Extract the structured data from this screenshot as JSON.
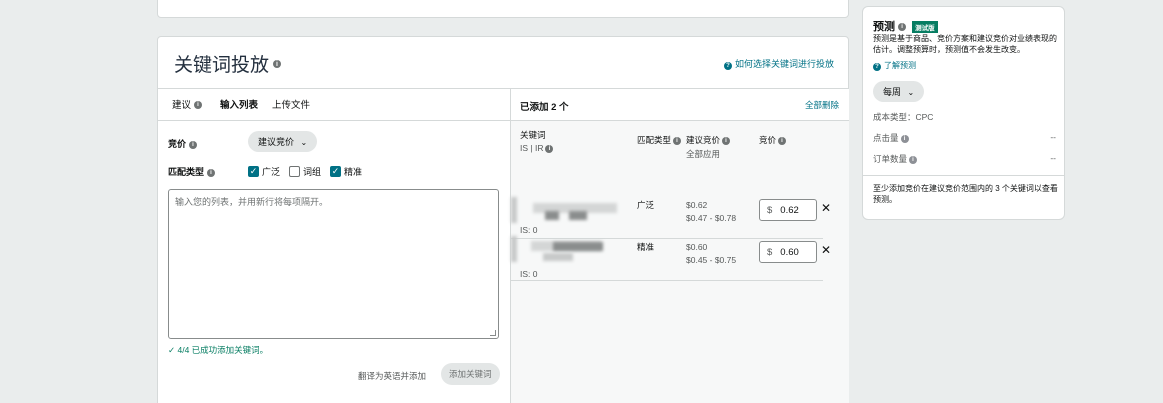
{
  "section": {
    "title": "关键词投放",
    "help_link": "如何选择关键词进行投放"
  },
  "tabs": [
    {
      "label": "建议"
    },
    {
      "label": "输入列表"
    },
    {
      "label": "上传文件"
    }
  ],
  "bid": {
    "label": "竞价",
    "dropdown_value": "建议竞价"
  },
  "match_type": {
    "label": "匹配类型",
    "options": [
      {
        "label": "广泛",
        "checked": true
      },
      {
        "label": "词组",
        "checked": false
      },
      {
        "label": "精准",
        "checked": true
      }
    ]
  },
  "textarea": {
    "placeholder": "输入您的列表，并用新行将每项隔开。"
  },
  "success_message": "4/4 已成功添加关键词。",
  "translate_label": "翻译为英语并添加",
  "add_keywords_button": "添加关键词",
  "added_panel": {
    "title": "已添加 2 个",
    "remove_all": "全部删除",
    "headers": {
      "keyword": "关键词",
      "keyword_sub": "IS | IR",
      "match_type": "匹配类型",
      "suggested_bid": "建议竞价",
      "suggested_sub": "全部应用",
      "bid": "竞价"
    },
    "rows": [
      {
        "is": "IS: 0",
        "match": "广泛",
        "suggested": "$0.62",
        "range": "$0.47 - $0.78",
        "currency": "$",
        "bid": "0.62"
      },
      {
        "is": "IS: 0",
        "match": "精准",
        "suggested": "$0.60",
        "range": "$0.45 - $0.75",
        "currency": "$",
        "bid": "0.60"
      }
    ]
  },
  "forecast": {
    "title": "预测",
    "badge": "测试版",
    "description": "预测是基于商品、竞价方案和建议竞价对业绩表现的估计。调整预算时，预测值不会发生改变。",
    "learn_link": "了解预测",
    "period": "每周",
    "cost_type": "成本类型：CPC",
    "clicks_label": "点击量",
    "clicks_value": "--",
    "orders_label": "订单数量",
    "orders_value": "--",
    "footer": "至少添加竞价在建议竞价范围内的 3 个关键词以查看预测。"
  }
}
